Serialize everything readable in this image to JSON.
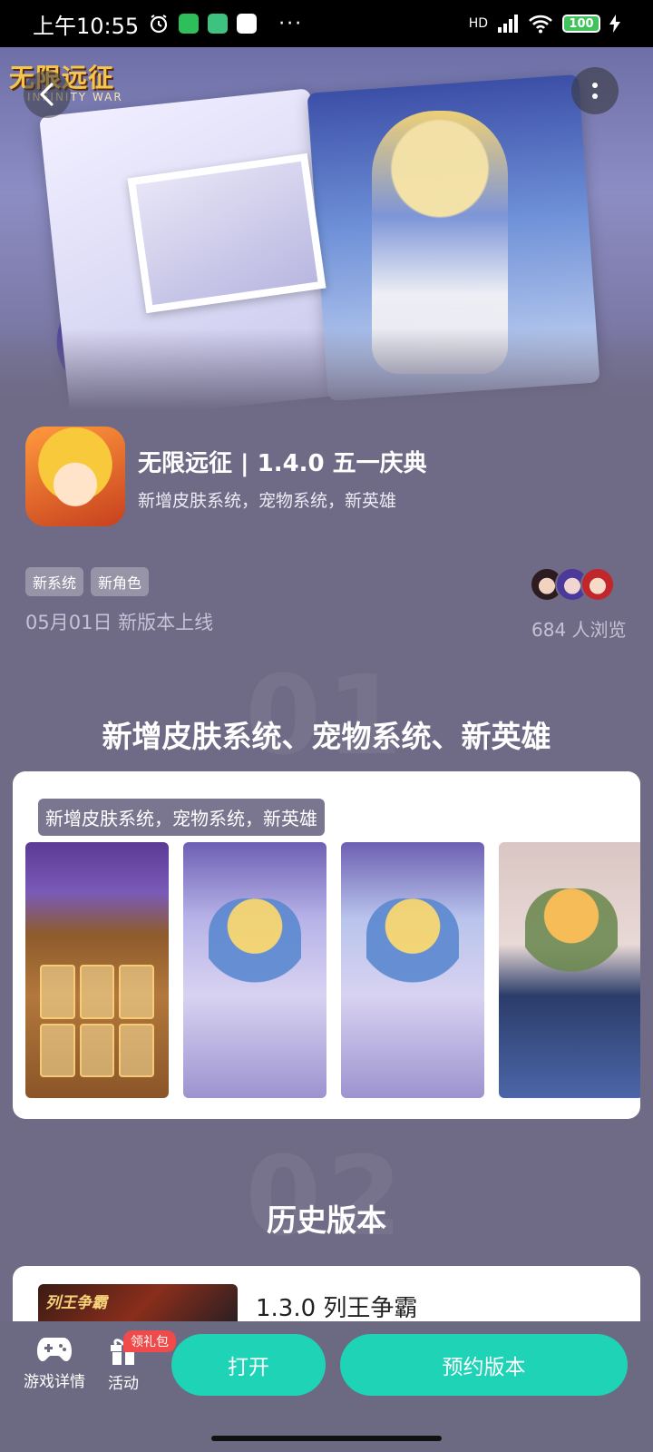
{
  "status_bar": {
    "time": "上午10:55",
    "more": "···",
    "network": "HD",
    "battery": "100"
  },
  "hero": {
    "logo_text": "无限远征",
    "logo_sub": "INFINITY WAR"
  },
  "app": {
    "title": "无限远征 | 1.4.0 五一庆典",
    "subtitle": "新增皮肤系统，宠物系统，新英雄"
  },
  "tags": [
    "新系统",
    "新角色"
  ],
  "release_date": "05月01日 新版本上线",
  "view_count": "684 人浏览",
  "section1": {
    "number": "01",
    "title": "新增皮肤系统、宠物系统、新英雄",
    "card_tag": "新增皮肤系统，宠物系统，新英雄"
  },
  "section2": {
    "number": "02",
    "title": "历史版本",
    "history_item": {
      "thumb_text": "列王争霸",
      "title": "1.3.0 列王争霸"
    }
  },
  "bottom_bar": {
    "game_details": "游戏详情",
    "activity": "活动",
    "gift_badge": "领礼包",
    "open_button": "打开",
    "reserve_button": "预约版本"
  },
  "colors": {
    "accent": "#1ed3b6",
    "background": "#6f6b86",
    "badge": "#f04a4a"
  }
}
